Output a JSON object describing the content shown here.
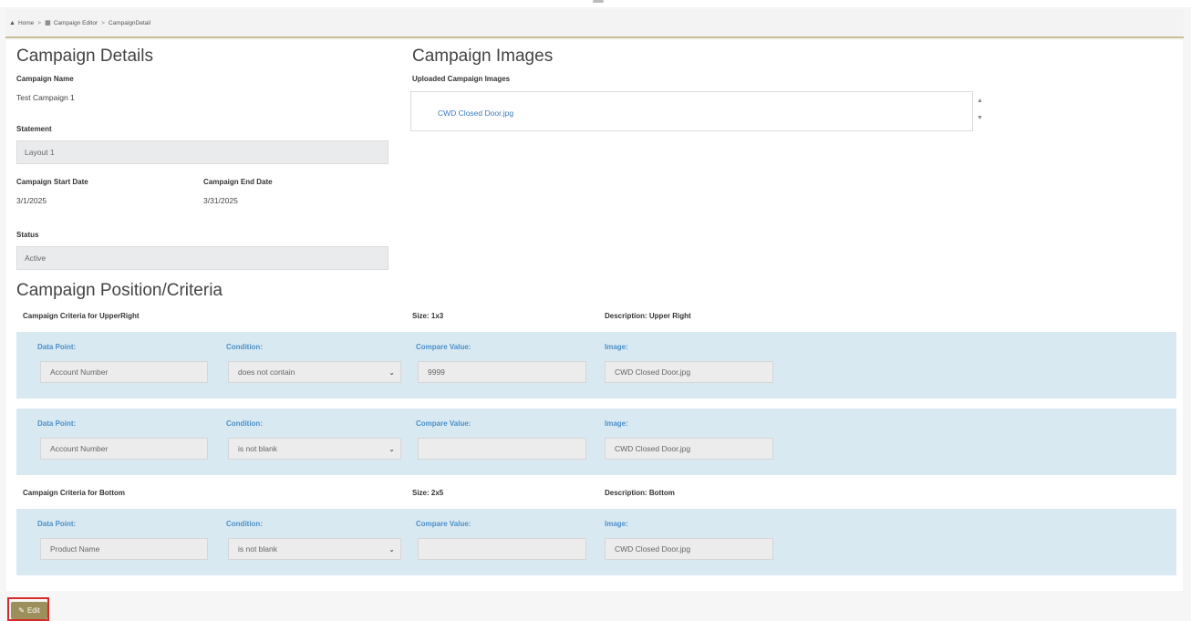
{
  "breadcrumb": {
    "home": "Home",
    "editor": "Campaign Editor",
    "current": "CampaignDetail"
  },
  "details": {
    "title": "Campaign Details",
    "name_label": "Campaign Name",
    "name_value": "Test Campaign 1",
    "statement_label": "Statement",
    "statement_value": "Layout 1",
    "start_label": "Campaign Start Date",
    "start_value": "3/1/2025",
    "end_label": "Campaign End Date",
    "end_value": "3/31/2025",
    "status_label": "Status",
    "status_value": "Active"
  },
  "images": {
    "title": "Campaign Images",
    "uploaded_label": "Uploaded Campaign Images",
    "files": [
      "CWD Closed Door.jpg"
    ]
  },
  "criteria": {
    "title": "Campaign Position/Criteria",
    "field_labels": {
      "data_point": "Data Point:",
      "condition": "Condition:",
      "compare": "Compare Value:",
      "image": "Image:"
    },
    "groups": [
      {
        "header": "Campaign Criteria for UpperRight",
        "size": "Size: 1x3",
        "description": "Description: Upper Right",
        "rows": [
          {
            "data_point": "Account Number",
            "condition": "does not contain",
            "compare": "9999",
            "image": "CWD Closed Door.jpg"
          },
          {
            "data_point": "Account Number",
            "condition": "is not blank",
            "compare": "",
            "image": "CWD Closed Door.jpg"
          }
        ]
      },
      {
        "header": "Campaign Criteria for Bottom",
        "size": "Size: 2x5",
        "description": "Description: Bottom",
        "rows": [
          {
            "data_point": "Product Name",
            "condition": "is not blank",
            "compare": "",
            "image": "CWD Closed Door.jpg"
          }
        ]
      }
    ]
  },
  "actions": {
    "edit_label": "Edit"
  },
  "colors": {
    "accent": "#9c8f5c",
    "row_bg": "#d9e9f2",
    "link": "#3a7bbf",
    "highlight": "#d62b2b"
  }
}
